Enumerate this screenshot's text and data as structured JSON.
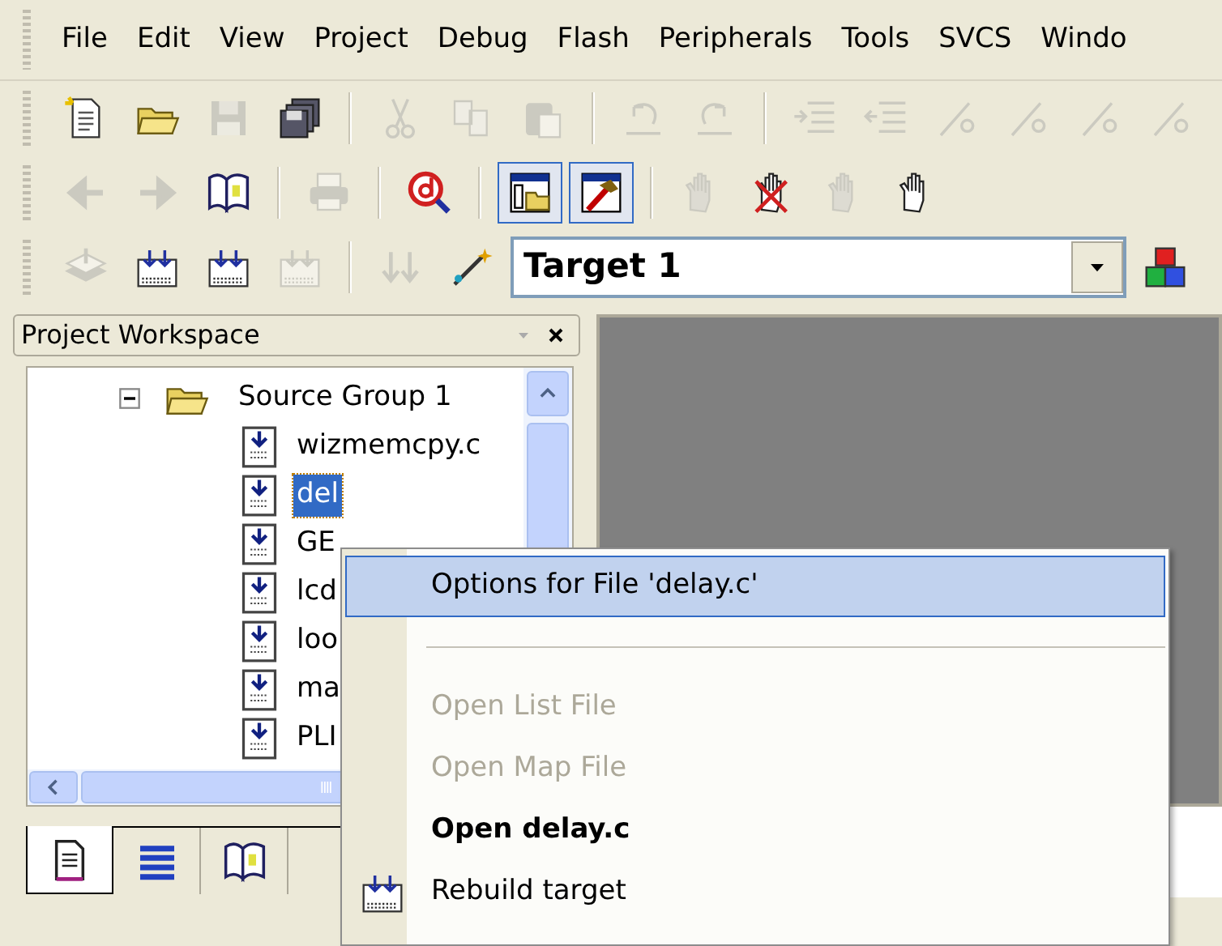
{
  "menu_bar": [
    {
      "label": "File"
    },
    {
      "label": "Edit"
    },
    {
      "label": "View"
    },
    {
      "label": "Project"
    },
    {
      "label": "Debug"
    },
    {
      "label": "Flash"
    },
    {
      "label": "Peripherals"
    },
    {
      "label": "Tools"
    },
    {
      "label": "SVCS"
    },
    {
      "label": "Windo"
    }
  ],
  "toolbars": [
    {
      "buttons": [
        {
          "kind": "new-page",
          "disabled": false,
          "pressed": false
        },
        {
          "kind": "folder",
          "disabled": false,
          "pressed": false
        },
        {
          "kind": "disk",
          "disabled": true,
          "pressed": false
        },
        {
          "kind": "disks",
          "disabled": false,
          "pressed": false
        },
        {
          "kind": "separator"
        },
        {
          "kind": "scissors",
          "disabled": true,
          "pressed": false
        },
        {
          "kind": "copy",
          "disabled": true,
          "pressed": false
        },
        {
          "kind": "clipboard",
          "disabled": true,
          "pressed": false
        },
        {
          "kind": "separator"
        },
        {
          "kind": "undo",
          "disabled": true,
          "pressed": false
        },
        {
          "kind": "redo",
          "disabled": true,
          "pressed": false
        },
        {
          "kind": "separator"
        },
        {
          "kind": "indent",
          "disabled": true,
          "pressed": false
        },
        {
          "kind": "outdent",
          "disabled": true,
          "pressed": false
        },
        {
          "kind": "flag",
          "disabled": true,
          "pressed": false
        },
        {
          "kind": "flag",
          "disabled": true,
          "pressed": false
        },
        {
          "kind": "flag",
          "disabled": true,
          "pressed": false
        },
        {
          "kind": "flag",
          "disabled": true,
          "pressed": false
        }
      ]
    },
    {
      "buttons": [
        {
          "kind": "arrow-left",
          "disabled": true,
          "pressed": false
        },
        {
          "kind": "arrow-right",
          "disabled": true,
          "pressed": false
        },
        {
          "kind": "book",
          "disabled": false,
          "pressed": false
        },
        {
          "kind": "separator"
        },
        {
          "kind": "printer",
          "disabled": true,
          "pressed": false
        },
        {
          "kind": "separator"
        },
        {
          "kind": "magnifier",
          "disabled": false,
          "pressed": false
        },
        {
          "kind": "separator"
        },
        {
          "kind": "window",
          "disabled": false,
          "pressed": true
        },
        {
          "kind": "hammer",
          "disabled": false,
          "pressed": true
        },
        {
          "kind": "separator"
        },
        {
          "kind": "hand",
          "disabled": true,
          "pressed": false
        },
        {
          "kind": "hand-cross",
          "disabled": false,
          "pressed": false
        },
        {
          "kind": "hand",
          "disabled": true,
          "pressed": false
        },
        {
          "kind": "hand",
          "disabled": false,
          "pressed": false
        }
      ]
    },
    {
      "buttons": [
        {
          "kind": "stack",
          "disabled": true,
          "pressed": false
        },
        {
          "kind": "build",
          "disabled": false,
          "pressed": false
        },
        {
          "kind": "build",
          "disabled": false,
          "pressed": false
        },
        {
          "kind": "build",
          "disabled": true,
          "pressed": false
        },
        {
          "kind": "separator"
        },
        {
          "kind": "load",
          "disabled": true,
          "pressed": false
        },
        {
          "kind": "wand",
          "disabled": false,
          "pressed": false
        },
        {
          "kind": "target-select"
        },
        {
          "kind": "blocks",
          "disabled": false,
          "pressed": false
        }
      ]
    }
  ],
  "target_select": {
    "value": "Target 1"
  },
  "workspace": {
    "title": "Project Workspace",
    "tree": [
      {
        "label": "Source Group 1",
        "expanded": true,
        "selected": false,
        "children": [
          {
            "label": "wizmemcpy.c",
            "selected": false
          },
          {
            "label": "del",
            "selected": true
          },
          {
            "label": "GE",
            "selected": false
          },
          {
            "label": "lcd",
            "selected": false
          },
          {
            "label": "loo",
            "selected": false
          },
          {
            "label": "ma",
            "selected": false
          },
          {
            "label": "PLI",
            "selected": false
          }
        ]
      }
    ],
    "tabs": [
      {
        "kind": "page",
        "selected": true
      },
      {
        "kind": "list",
        "selected": false
      },
      {
        "kind": "book",
        "selected": false
      }
    ]
  },
  "context_menu": {
    "items": [
      {
        "kind": "item",
        "label": "Options for File 'delay.c'",
        "highlighted": true,
        "disabled": false,
        "bold": false,
        "icon": false
      },
      {
        "kind": "separator"
      },
      {
        "kind": "item",
        "label": "Open List File",
        "highlighted": false,
        "disabled": true,
        "bold": false,
        "icon": false
      },
      {
        "kind": "item",
        "label": "Open Map File",
        "highlighted": false,
        "disabled": true,
        "bold": false,
        "icon": false
      },
      {
        "kind": "item",
        "label": "Open delay.c",
        "highlighted": false,
        "disabled": false,
        "bold": true,
        "icon": false
      },
      {
        "kind": "item",
        "label": "Rebuild target",
        "highlighted": false,
        "disabled": false,
        "bold": false,
        "icon": true
      }
    ]
  }
}
